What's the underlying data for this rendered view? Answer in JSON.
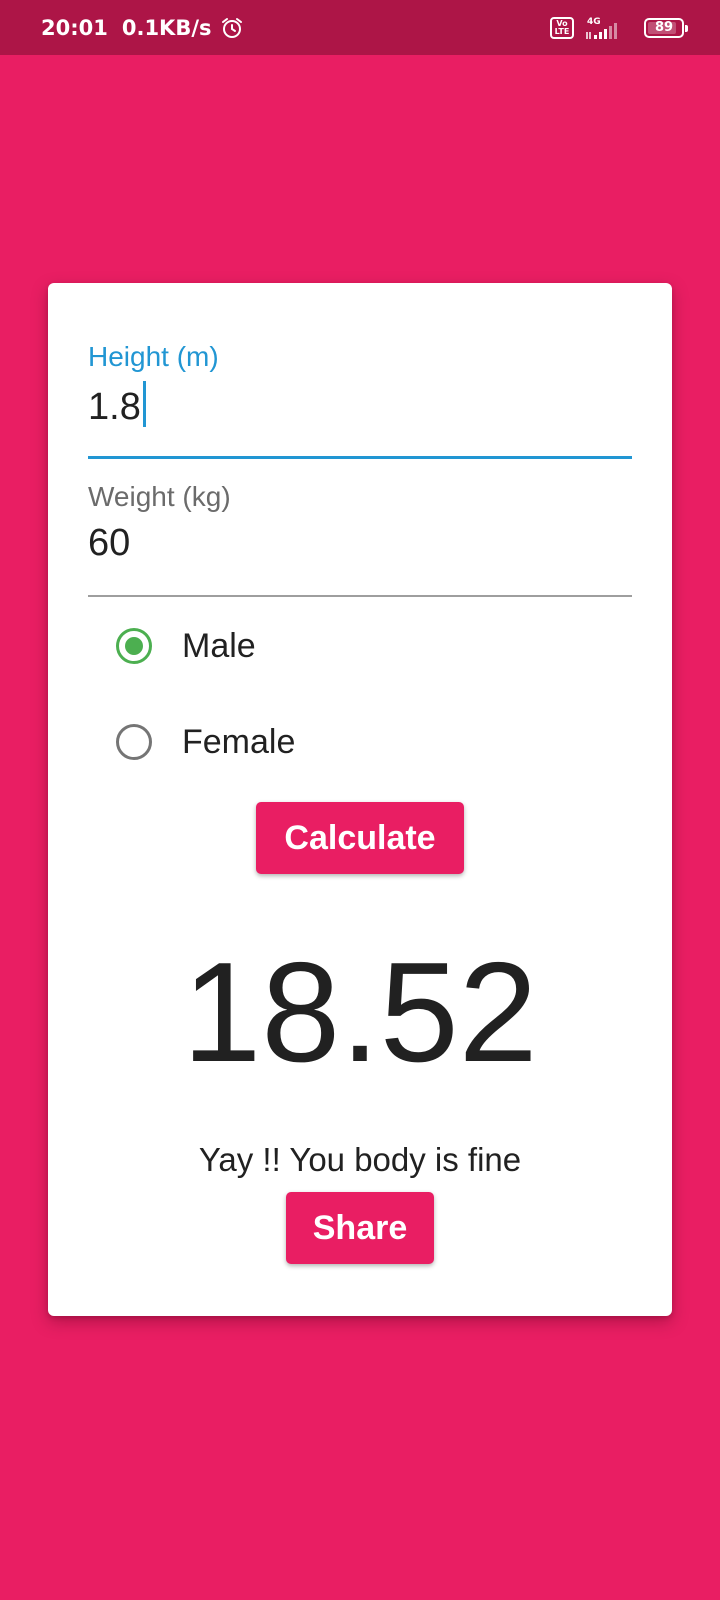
{
  "status_bar": {
    "time": "20:01",
    "speed": "0.1KB/s",
    "volte_top": "Vo",
    "volte_bottom": "LTE",
    "network": "4G",
    "battery": "89",
    "battery_fraction": 0.89
  },
  "form": {
    "height_label": "Height (m)",
    "height_value": "1.8",
    "weight_label": "Weight (kg)",
    "weight_value": "60",
    "gender_options": [
      {
        "label": "Male",
        "checked": true
      },
      {
        "label": "Female",
        "checked": false
      }
    ],
    "calculate_label": "Calculate"
  },
  "result": {
    "bmi": "18.52",
    "message": "Yay !! You body is fine",
    "share_label": "Share"
  },
  "colors": {
    "background": "#e91e63",
    "status_bar": "#ad1547",
    "focused_field": "#2196d3",
    "radio_checked": "#4caf50"
  }
}
